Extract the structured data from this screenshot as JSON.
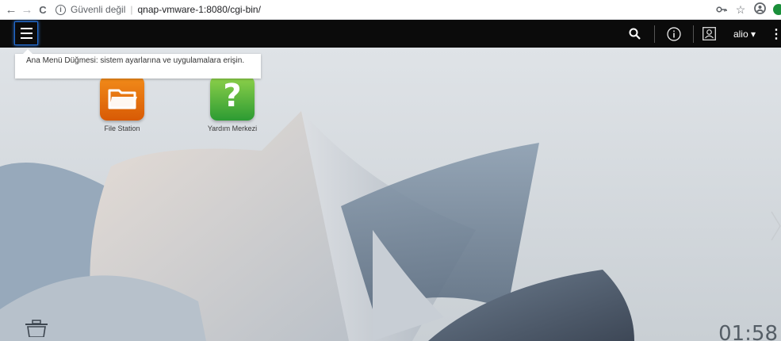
{
  "browser": {
    "back_icon": "←",
    "forward_icon": "→",
    "reload_icon": "C",
    "info_icon": "i",
    "security_label": "Güvenli değil",
    "separator": "|",
    "url": "qnap-vmware-1:8080/cgi-bin/",
    "key_icon": "o",
    "star_icon": "☆",
    "account_icon": "⊖"
  },
  "topbar": {
    "username": "alio ▾",
    "more": "⋮"
  },
  "tooltip": {
    "text": "Ana Menü Düğmesi: sistem ayarlarına ve uygulamalara erişin."
  },
  "apps": [
    {
      "label": "File Station",
      "icon": "folder-icon",
      "color": "#f07a10"
    },
    {
      "label": "Yardım Merkezi",
      "icon": "help-icon",
      "color": "#4bb33c",
      "glyph": "?"
    }
  ],
  "clock": {
    "time": "01:58"
  },
  "colors": {
    "topbar": "#0b0b0b",
    "menu_focus": "#1f6ad1"
  }
}
